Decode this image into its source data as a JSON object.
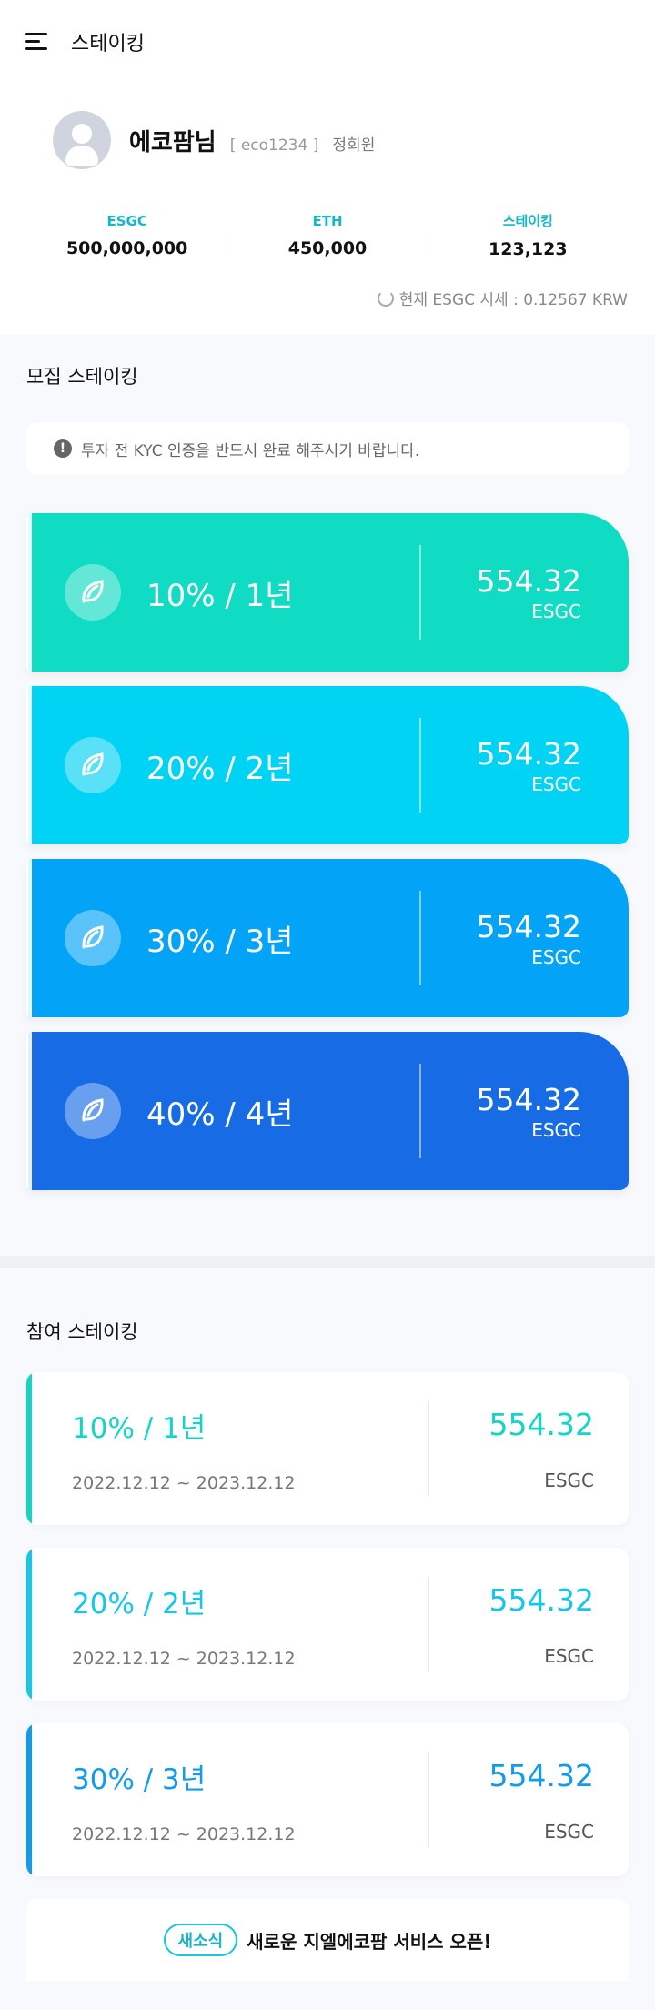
{
  "header": {
    "title": "스테이킹",
    "menu_icon": "hamburger-menu-icon"
  },
  "profile": {
    "name": "에코팜님",
    "id": "[ eco1234 ]",
    "grade": "정회원",
    "balances": [
      {
        "label": "ESGC",
        "value": "500,000,000"
      },
      {
        "label": "ETH",
        "value": "450,000"
      },
      {
        "label": "스테이킹",
        "value": "123,123"
      }
    ],
    "price_text": "현재 ESGC 시세 : 0.12567 KRW"
  },
  "recruit": {
    "title": "모집 스테이킹",
    "notice": "투자 전 KYC 인증을 반드시 완료 해주시기 바랍니다.",
    "cards": [
      {
        "rate": "10% / 1년",
        "amount": "554.32",
        "unit": "ESGC",
        "color": "#10dcc3"
      },
      {
        "rate": "20% / 2년",
        "amount": "554.32",
        "unit": "ESGC",
        "color": "#00d3f3"
      },
      {
        "rate": "30% / 3년",
        "amount": "554.32",
        "unit": "ESGC",
        "color": "#03a3f7"
      },
      {
        "rate": "40% / 4년",
        "amount": "554.32",
        "unit": "ESGC",
        "color": "#176ce6"
      }
    ]
  },
  "participated": {
    "title": "참여 스테이킹",
    "cards": [
      {
        "rate": "10% / 1년",
        "period": "2022.12.12 ~ 2023.12.12",
        "amount": "554.32",
        "unit": "ESGC",
        "color": "#14d5c5"
      },
      {
        "rate": "20% / 2년",
        "period": "2022.12.12 ~ 2023.12.12",
        "amount": "554.32",
        "unit": "ESGC",
        "color": "#13c7e9"
      },
      {
        "rate": "30% / 3년",
        "period": "2022.12.12 ~ 2023.12.12",
        "amount": "554.32",
        "unit": "ESGC",
        "color": "#109bef"
      }
    ]
  },
  "news": {
    "badge": "새소식",
    "text": "새로운 지엘에코팜 서비스 오픈!"
  }
}
